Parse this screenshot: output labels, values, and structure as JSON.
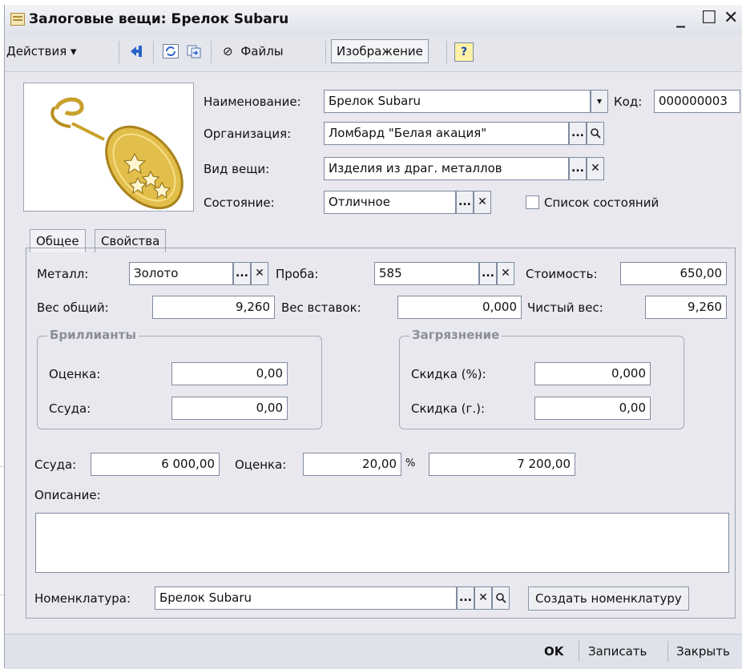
{
  "window": {
    "title": "Залоговые вещи: Брелок Subaru",
    "controls": {
      "minimize": "_",
      "maximize": "☐",
      "close": "✕"
    }
  },
  "toolbar": {
    "actions": "Действия ▾",
    "files": "Файлы",
    "image": "Изображение",
    "help": "?"
  },
  "header": {
    "name_label": "Наименование:",
    "name_value": "Брелок Subaru",
    "code_label": "Код:",
    "code_value": "000000003",
    "org_label": "Организация:",
    "org_value": "Ломбард \"Белая акация\"",
    "type_label": "Вид вещи:",
    "type_value": "Изделия из драг. металлов",
    "state_label": "Состояние:",
    "state_value": "Отличное",
    "state_list_label": "Список состояний",
    "state_list_checked": false
  },
  "tabs": [
    {
      "label": "Общее",
      "active": true
    },
    {
      "label": "Свойства",
      "active": false
    }
  ],
  "general": {
    "metal_label": "Металл:",
    "metal_value": "Золото",
    "probe_label": "Проба:",
    "probe_value": "585",
    "cost_label": "Стоимость:",
    "cost_value": "650,00",
    "gross_weight_label": "Вес общий:",
    "gross_weight_value": "9,260",
    "inserts_weight_label": "Вес вставок:",
    "inserts_weight_value": "0,000",
    "net_weight_label": "Чистый вес:",
    "net_weight_value": "9,260",
    "diamonds": {
      "title": "Бриллианты",
      "estimate_label": "Оценка:",
      "estimate_value": "0,00",
      "loan_label": "Ссуда:",
      "loan_value": "0,00"
    },
    "dirt": {
      "title": "Загрязнение",
      "discount_pct_label": "Скидка (%):",
      "discount_pct_value": "0,000",
      "discount_g_label": "Скидка (г.):",
      "discount_g_value": "0,00"
    },
    "loan_label": "Ссуда:",
    "loan_value": "6 000,00",
    "estimate_label": "Оценка:",
    "estimate_pct_value": "20,00",
    "percent_sign": "%",
    "estimate_total_value": "7 200,00",
    "description_label": "Описание:",
    "description_value": "",
    "nomenclature_label": "Номенклатура:",
    "nomenclature_value": "Брелок Subaru",
    "create_nomenclature": "Создать номенклатуру"
  },
  "footer": {
    "ok": "OK",
    "save": "Записать",
    "close": "Закрыть"
  },
  "icons": {
    "ellipsis": "...",
    "clear": "✕",
    "dropdown": "▾",
    "search": "⚲",
    "paperclip": "🖇"
  }
}
